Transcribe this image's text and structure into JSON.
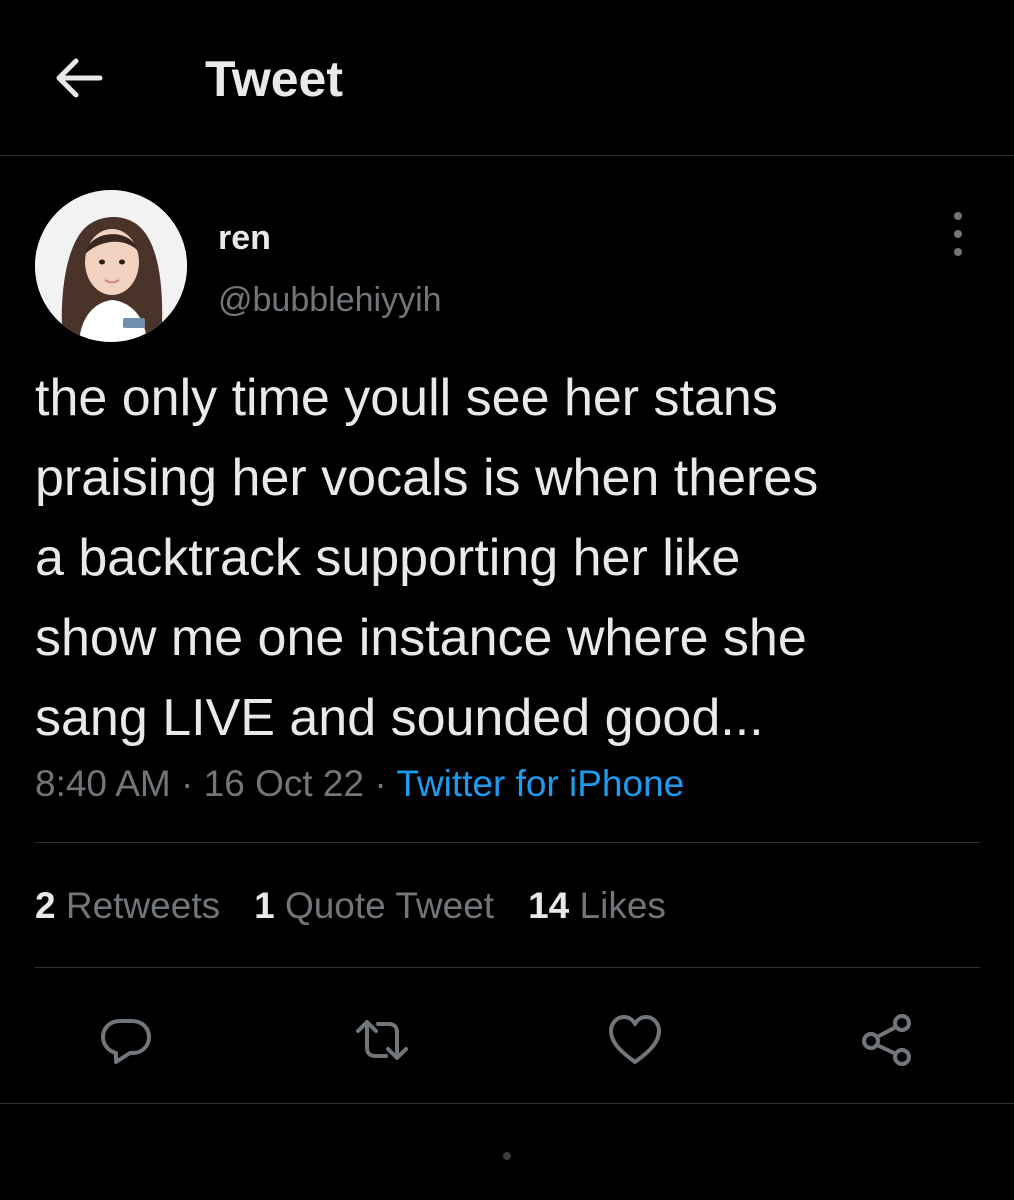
{
  "header": {
    "title": "Tweet",
    "back_icon": "arrow-left-icon"
  },
  "tweet": {
    "author": {
      "display_name": "ren",
      "handle": "@bubblehiyyih"
    },
    "text_lines": [
      "the only time youll see her stans",
      "praising her vocals is when theres",
      "a backtrack supporting her like",
      "show me one instance where she",
      "sang LIVE and sounded good..."
    ],
    "time": "8:40 AM",
    "separator": "·",
    "date": "16 Oct 22",
    "source": "Twitter for iPhone"
  },
  "stats": {
    "retweets_count": "2",
    "retweets_label": "Retweets",
    "quotes_count": "1",
    "quotes_label": "Quote Tweet",
    "likes_count": "14",
    "likes_label": "Likes"
  },
  "actions": {
    "icons": [
      "reply-icon",
      "retweet-icon",
      "like-icon",
      "share-icon"
    ]
  },
  "colors": {
    "background": "#000000",
    "text": "#e7e9ea",
    "muted": "#71767b",
    "link": "#1d9bf0",
    "divider": "#2f3336"
  }
}
